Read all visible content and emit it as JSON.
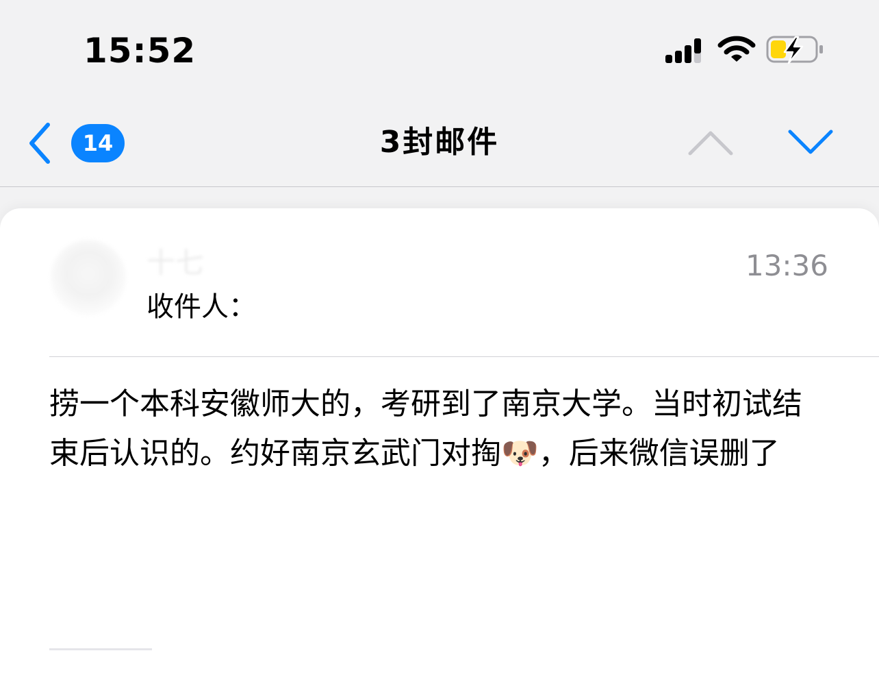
{
  "status_bar": {
    "time": "15:52",
    "icons": [
      "signal-icon",
      "wifi-icon",
      "battery-charging-icon"
    ]
  },
  "nav": {
    "back_badge": "14",
    "title": "3封邮件",
    "icons": [
      "back-chevron-icon",
      "chevron-up-icon",
      "chevron-down-icon"
    ]
  },
  "mail": {
    "sender": "十七",
    "recipient_label": "收件人：",
    "recipient": "",
    "time": "13:36",
    "body": "捞一个本科安徽师大的，考研到了南京大学。当时初试结束后认识的。约好南京玄武门对掏🐶，后来微信误删了"
  },
  "colors": {
    "accent": "#0a84ff",
    "battery_fill": "#ffd60a",
    "background": "#f2f2f3",
    "secondary_text": "#8e8e93"
  }
}
